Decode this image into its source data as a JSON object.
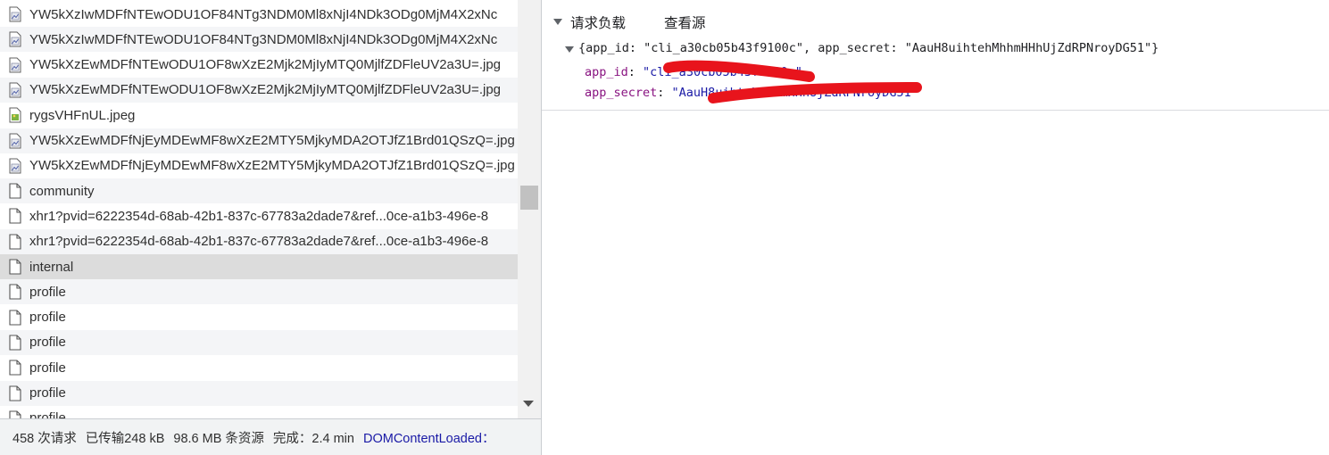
{
  "requests": [
    {
      "name": "YW5kXzIwMDFfNTEwODU1OF84NTg3NDM0Ml8xNjI4NDk3ODg0MjM4X2xNc",
      "icon": "doc-image-icon"
    },
    {
      "name": "YW5kXzIwMDFfNTEwODU1OF84NTg3NDM0Ml8xNjI4NDk3ODg0MjM4X2xNc",
      "icon": "doc-image-icon"
    },
    {
      "name": "YW5kXzEwMDFfNTEwODU1OF8wXzE2Mjk2MjIyMTQ0MjlfZDFleUV2a3U=.jpg",
      "icon": "doc-image-icon"
    },
    {
      "name": "YW5kXzEwMDFfNTEwODU1OF8wXzE2Mjk2MjIyMTQ0MjlfZDFleUV2a3U=.jpg",
      "icon": "doc-image-icon"
    },
    {
      "name": "rygsVHFnUL.jpeg",
      "icon": "image-file-icon"
    },
    {
      "name": "YW5kXzEwMDFfNjEyMDEwMF8wXzE2MTY5MjkyMDA2OTJfZ1Brd01QSzQ=.jpg",
      "icon": "doc-image-icon"
    },
    {
      "name": "YW5kXzEwMDFfNjEyMDEwMF8wXzE2MTY5MjkyMDA2OTJfZ1Brd01QSzQ=.jpg",
      "icon": "doc-image-icon"
    },
    {
      "name": "community",
      "icon": "document-icon"
    },
    {
      "name": "xhr1?pvid=6222354d-68ab-42b1-837c-67783a2dade7&ref...0ce-a1b3-496e-8",
      "icon": "document-icon"
    },
    {
      "name": "xhr1?pvid=6222354d-68ab-42b1-837c-67783a2dade7&ref...0ce-a1b3-496e-8",
      "icon": "document-icon"
    },
    {
      "name": "internal",
      "icon": "document-icon"
    },
    {
      "name": "profile",
      "icon": "document-icon"
    },
    {
      "name": "profile",
      "icon": "document-icon"
    },
    {
      "name": "profile",
      "icon": "document-icon"
    },
    {
      "name": "profile",
      "icon": "document-icon"
    },
    {
      "name": "profile",
      "icon": "document-icon"
    },
    {
      "name": "profile",
      "icon": "document-icon"
    }
  ],
  "selected_index": 10,
  "status": {
    "requests": "458 次请求",
    "transferred": "已传输248 kB",
    "resources": "98.6 MB 条资源",
    "finish": "完成：2.4 min",
    "dcl": "DOMContentLoaded："
  },
  "payload": {
    "section_title": "请求负载",
    "view_source": "查看源",
    "object_summary_open": "{app_id: ",
    "app_id_full": "\"cli_a30cb05b43f9100c\"",
    "sep": ", app_secret: ",
    "app_secret_full": "\"AauH8uihtehMhhmHHhUjZdRPNroyDG51\"",
    "object_summary_close": "}",
    "prop1_key": "app_id",
    "prop1_value": "\"cli_a30cb05b43f9100c\"",
    "prop2_key": "app_secret",
    "prop2_value": "\"AauH8uihtehMhhmHHhUjZdRPNroyDG51\"",
    "colon": ": "
  },
  "colors": {
    "redaction": "#e8141c",
    "selected_row": "#dcdcdc",
    "key": "#881280",
    "string": "#1a1aa6"
  }
}
